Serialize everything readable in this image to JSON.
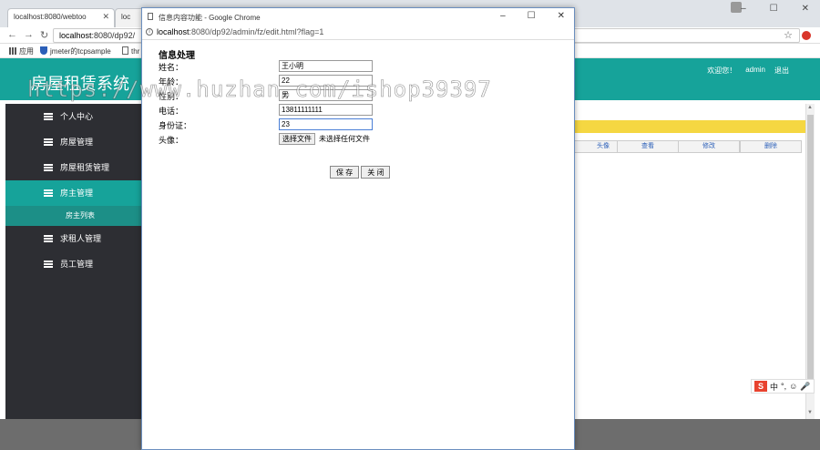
{
  "browser": {
    "tabs": [
      {
        "label": "localhost:8080/webtoo"
      },
      {
        "label": "loc"
      }
    ],
    "url": {
      "host": "localhost",
      "path": ":8080/dp92/"
    },
    "bookmarks": [
      {
        "label": "应用"
      },
      {
        "label": "jmeter的tcpsample"
      },
      {
        "label": "thr"
      }
    ]
  },
  "header": {
    "site_title": "房屋租赁系统",
    "welcome": "欢迎您！",
    "user": "admin",
    "logout": "退出"
  },
  "sidebar": {
    "items": [
      {
        "label": "个人中心"
      },
      {
        "label": "房屋管理"
      },
      {
        "label": "房屋租赁管理"
      },
      {
        "label": "房主管理"
      },
      {
        "label": "求租人管理"
      },
      {
        "label": "员工管理"
      }
    ],
    "submenu": {
      "label": "房主列表"
    }
  },
  "table": {
    "columns": [
      "头像",
      "查看",
      "修改",
      "删除"
    ]
  },
  "popup": {
    "title": "信息内容功能 - Google Chrome",
    "url": {
      "host": "localhost",
      "path": ":8080/dp92/admin/fz/edit.html?flag=1"
    },
    "form_title": "信息处理",
    "fields": [
      {
        "label": "姓名：",
        "value": "王小明"
      },
      {
        "label": "年龄：",
        "value": "22"
      },
      {
        "label": "性别：",
        "value": "男"
      },
      {
        "label": "电话：",
        "value": "13811111111"
      },
      {
        "label": "身份证：",
        "value": "23"
      }
    ],
    "avatar_label": "头像：",
    "file_button": "选择文件",
    "file_status": "未选择任何文件",
    "save_button": "保 存",
    "close_button": "关 闭"
  },
  "ime": {
    "mode": "中"
  },
  "watermark": "https://www.huzhan.com/ishop39397"
}
